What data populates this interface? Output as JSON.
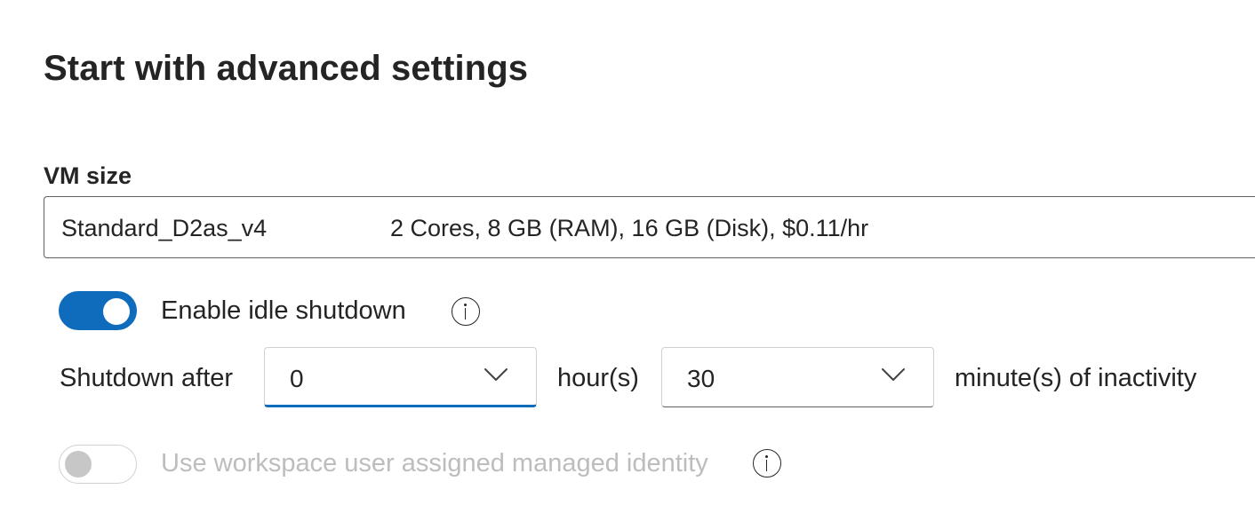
{
  "page": {
    "title": "Start with advanced settings"
  },
  "vm_size": {
    "label": "VM size",
    "selected_name": "Standard_D2as_v4",
    "selected_specs": "2 Cores, 8 GB (RAM), 16 GB (Disk), $0.11/hr"
  },
  "idle_shutdown": {
    "label": "Enable idle shutdown",
    "enabled": true,
    "info_icon": "info-icon",
    "prefix_label": "Shutdown after",
    "hours_value": "0",
    "hours_unit_label": "hour(s)",
    "minutes_value": "30",
    "minutes_unit_label": "minute(s) of inactivity",
    "dropdown_icon": "chevron-down-icon"
  },
  "managed_identity": {
    "label": "Use workspace user assigned managed identity",
    "enabled": false,
    "disabled": true,
    "info_icon": "info-icon"
  },
  "colors": {
    "accent": "#0f6cbd",
    "text": "#242424",
    "disabled_text": "#bdbdbd",
    "border": "#616161"
  }
}
